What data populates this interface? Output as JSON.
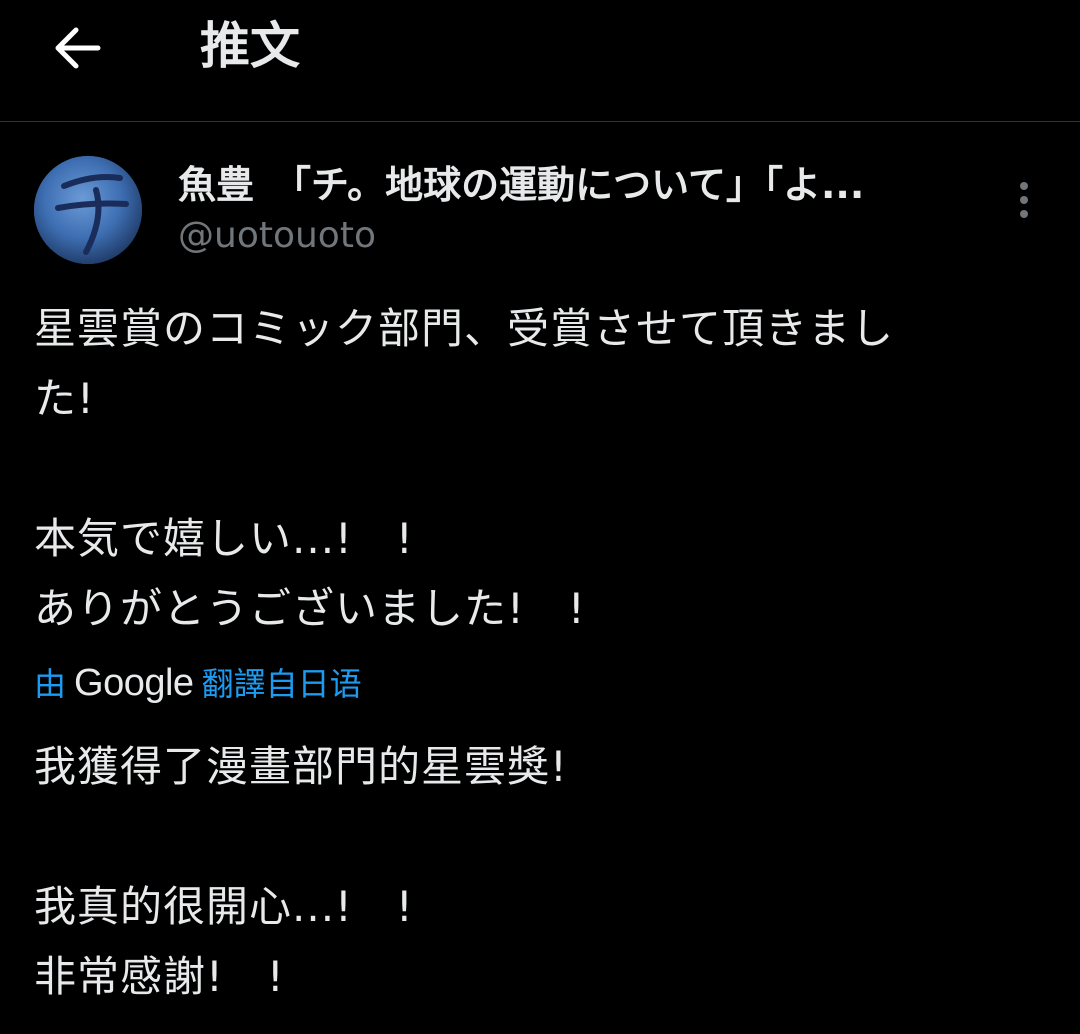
{
  "header": {
    "title": "推文"
  },
  "tweet": {
    "author_name": "魚豊　「チ。地球の運動について」「よ...",
    "author_handle": "@uotouoto",
    "original_lines": [
      "星雲賞のコミック部門、受賞させて頂きまし",
      "た!",
      "",
      "本気で嬉しい...!　!",
      "ありがとうございました!　!"
    ],
    "translation_by": "由",
    "translation_provider": "Google",
    "translation_from": "翻譯自日语",
    "translated_lines": [
      "我獲得了漫畫部門的星雲獎!",
      "",
      "我真的很開心...!　!",
      "非常感謝!　!"
    ]
  },
  "icons": {
    "back": "arrow-left-icon",
    "more": "more-vertical-icon",
    "avatar_glyph": "チ"
  },
  "colors": {
    "background": "#000000",
    "text": "#e7e9ea",
    "secondary_text": "#71767b",
    "link": "#1d9bf0",
    "divider": "#2f3336"
  }
}
